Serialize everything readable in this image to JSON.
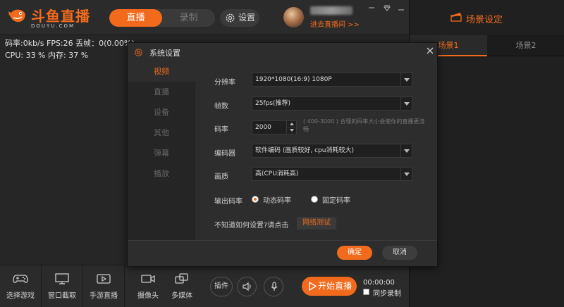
{
  "app": {
    "logo_text": "斗鱼直播",
    "logo_sub": "DOUYU.COM"
  },
  "header": {
    "mode_live": "直播",
    "mode_record": "录制",
    "settings": "设置",
    "enter_room": "进去直播间 >>"
  },
  "stats": {
    "line1": "码率:0kb/s   FPS:26  丢帧：0(0.00%)",
    "line2": "CPU: 33 %    内存: 37 %"
  },
  "scene": {
    "title": "场景设定",
    "tabs": [
      {
        "label": "场景1"
      },
      {
        "label": "场景2"
      }
    ]
  },
  "dialog": {
    "title": "系统设置",
    "nav": [
      {
        "label": "视频"
      },
      {
        "label": "直播"
      },
      {
        "label": "设备"
      },
      {
        "label": "其他"
      },
      {
        "label": "弹幕"
      },
      {
        "label": "播放"
      }
    ],
    "resolution_label": "分辨率",
    "resolution_value": "1920*1080(16:9) 1080P",
    "fps_label": "帧数",
    "fps_value": "25fps(推荐)",
    "bitrate_label": "码率",
    "bitrate_value": "2000",
    "bitrate_hint": "( 400-3000 ) 合理的码率大小会使你的直播更流畅",
    "encoder_label": "编码器",
    "encoder_value": "软件编码 (画质较好, cpu消耗较大)",
    "quality_label": "画质",
    "quality_value": "高(CPU消耗高)",
    "output_label": "输出码率",
    "output_options": [
      {
        "label": "动态码率",
        "selected": true
      },
      {
        "label": "固定码率",
        "selected": false
      }
    ],
    "help_text": "不知道如何设置?请点击",
    "net_test": "网络测试",
    "ok": "确定",
    "cancel": "取消"
  },
  "toolbar": {
    "tools": [
      {
        "label": "选择游戏",
        "icon": "gamepad-icon"
      },
      {
        "label": "窗口截取",
        "icon": "monitor-icon"
      },
      {
        "label": "手游直播",
        "icon": "mobile-icon"
      },
      {
        "label": "摄像头",
        "icon": "camera-icon"
      },
      {
        "label": "多媒体",
        "icon": "media-icon"
      }
    ],
    "plugin": "插件",
    "start_live": "开始直播",
    "timer": "00:00:00",
    "sync_record": "同步录制"
  },
  "colors": {
    "accent": "#f26b1d",
    "bg": "#262626",
    "panel": "#2d2d2d"
  }
}
